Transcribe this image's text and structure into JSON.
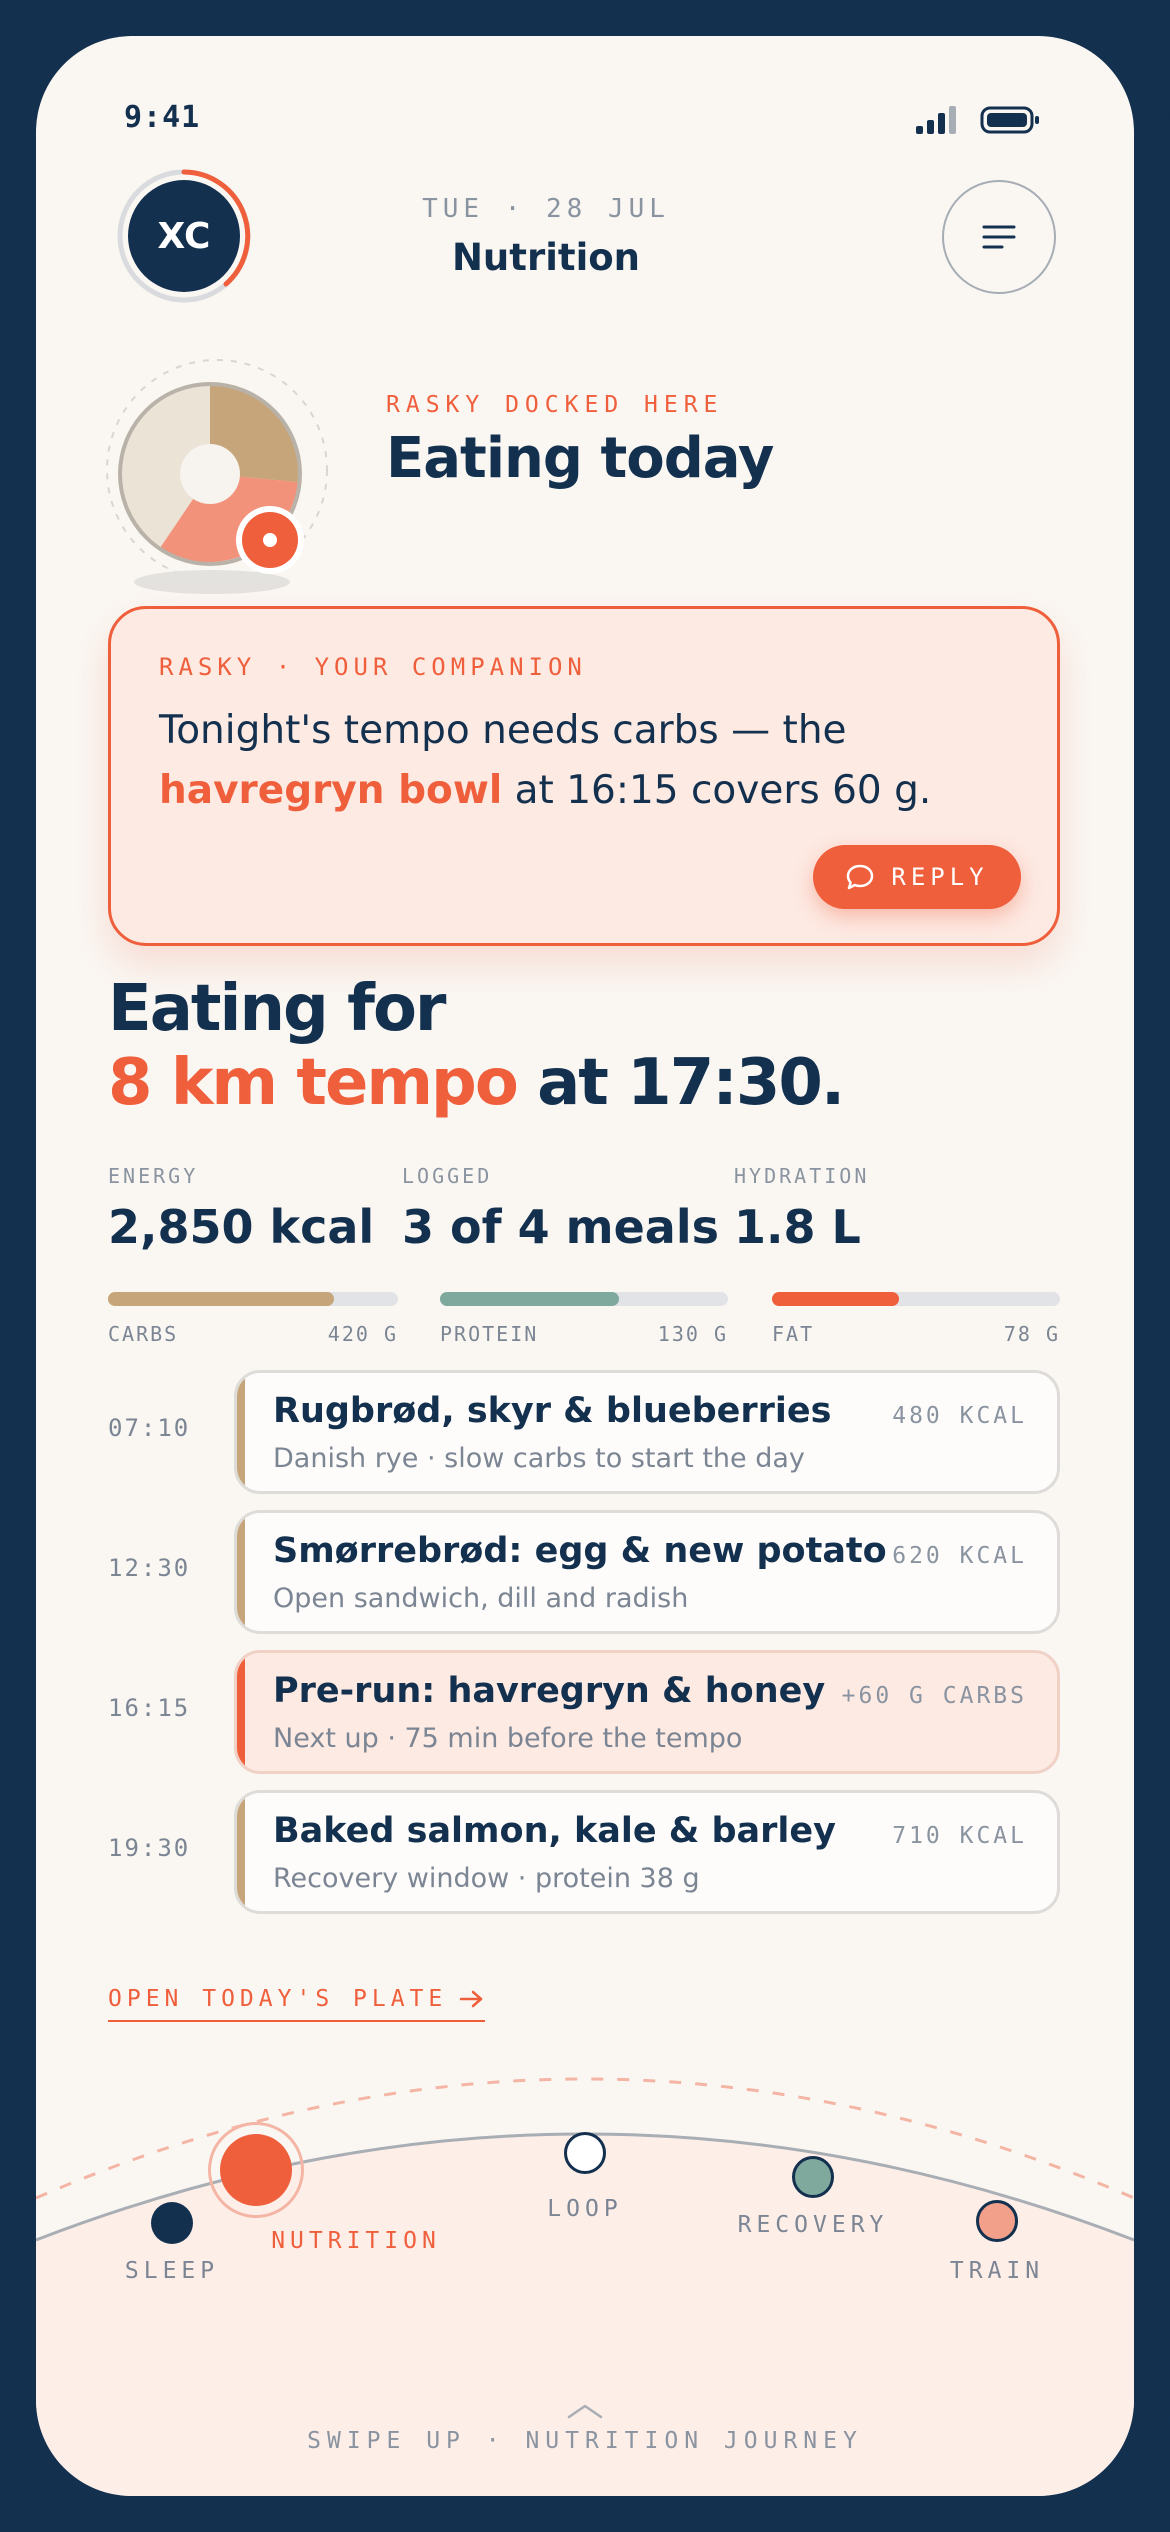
{
  "status": {
    "time": "9:41"
  },
  "header": {
    "avatar_initials": "XC",
    "date": "TUE · 28 JUL",
    "title": "Nutrition"
  },
  "mascot": {
    "docked_label": "RASKY DOCKED HERE",
    "heading": "Eating today"
  },
  "companion": {
    "label": "RASKY · YOUR COMPANION",
    "message_before": "Tonight's tempo needs carbs — the",
    "message_highlight": "havregryn bowl",
    "message_after": " at 16:15 covers 60 g.",
    "reply_label": "REPLY"
  },
  "headline": {
    "line1": "Eating for",
    "accent": "8 km tempo",
    "rest": " at 17:30."
  },
  "stats": [
    {
      "label": "ENERGY",
      "value": "2,850 kcal"
    },
    {
      "label": "LOGGED",
      "value": "3 of 4 meals"
    },
    {
      "label": "HYDRATION",
      "value": "1.8 L"
    }
  ],
  "macros": [
    {
      "name": "CARBS",
      "amount": "420 G",
      "progress": 0.78,
      "color": "#c7a57b"
    },
    {
      "name": "PROTEIN",
      "amount": "130 G",
      "progress": 0.62,
      "color": "#7fa99c"
    },
    {
      "name": "FAT",
      "amount": "78 G",
      "progress": 0.44,
      "color": "#ef5f3c"
    }
  ],
  "meals": [
    {
      "time": "07:10",
      "title": "Rugbrød, skyr & blueberries",
      "subtitle": "Danish rye · slow carbs to start the day",
      "kcal": "480 KCAL"
    },
    {
      "time": "12:30",
      "title": "Smørrebrød: egg & new potato",
      "subtitle": "Open sandwich, dill and radish",
      "kcal": "620 KCAL"
    },
    {
      "time": "16:15",
      "title": "Pre-run: havregryn & honey",
      "subtitle": "Next up · 75 min before the tempo",
      "kcal": "+60 G CARBS"
    },
    {
      "time": "19:30",
      "title": "Baked salmon, kale & barley",
      "subtitle": "Recovery window · protein 38 g",
      "kcal": "710 KCAL"
    }
  ],
  "open_plate_label": "OPEN TODAY'S PLATE",
  "journey": {
    "nodes": [
      "SLEEP",
      "NUTRITION",
      "LOOP",
      "RECOVERY",
      "TRAIN"
    ],
    "active": "NUTRITION"
  },
  "footer": {
    "swipe_hint": "SWIPE UP · NUTRITION JOURNEY"
  },
  "colors": {
    "navy": "#13304f",
    "accent": "#ef5f3c",
    "carbs": "#c7a57b",
    "protein": "#7fa99c",
    "background": "#faf7f3"
  },
  "icons": [
    "signal-icon",
    "battery-icon",
    "menu-icon",
    "chat-bubble-icon",
    "arrow-right-icon",
    "chevron-up-icon"
  ]
}
